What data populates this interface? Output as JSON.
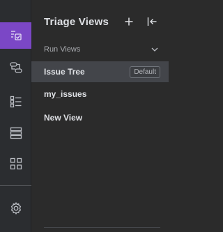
{
  "rail": {
    "items": [
      {
        "icon": "checklist-icon",
        "active": true
      },
      {
        "icon": "pipeline-icon",
        "active": false
      },
      {
        "icon": "list-view-icon",
        "active": false
      },
      {
        "icon": "server-icon",
        "active": false
      },
      {
        "icon": "grid-icon",
        "active": false
      },
      {
        "icon": "gear-icon",
        "active": false
      }
    ],
    "accent": "#7b47c6"
  },
  "panel": {
    "title": "Triage Views",
    "add_icon": "plus-icon",
    "collapse_icon": "collapse-left-icon",
    "section_label": "Run Views",
    "section_icon": "chevron-down-icon",
    "views": [
      {
        "label": "Issue Tree",
        "badge": "Default",
        "selected": true
      },
      {
        "label": "my_issues",
        "selected": false
      },
      {
        "label": "New View",
        "selected": false
      }
    ]
  }
}
